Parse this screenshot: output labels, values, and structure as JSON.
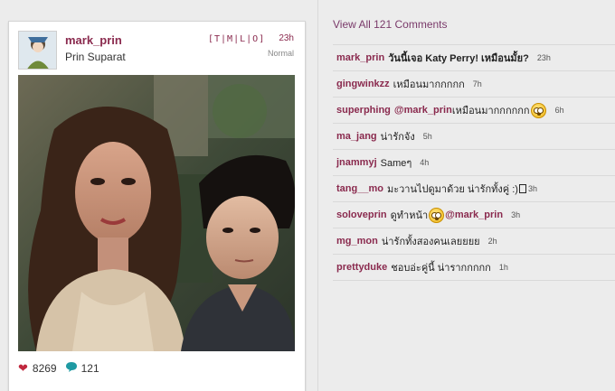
{
  "post": {
    "username": "mark_prin",
    "fullname": "Prin Suparat",
    "filters": "[T|M|L|O]",
    "time": "23h",
    "filter_name": "Normal",
    "likes": "8269",
    "comments_count": "121",
    "heart_icon": "heart-icon",
    "comment_icon": "speech-bubble-icon"
  },
  "comments_panel": {
    "view_all": "View All 121 Comments",
    "comments": [
      {
        "user": "mark_prin",
        "text": "วันนี้เจอ Katy Perry! เหมือนมั้ย?",
        "time": "23h"
      },
      {
        "user": "gingwinkzz",
        "text": "เหมือนมากกกกก",
        "time": "7h"
      },
      {
        "user": "superphing",
        "mention": "@mark_prin",
        "text": "เหมือนมากกกกกก",
        "emoji": "flushed-face-icon",
        "time": "6h"
      },
      {
        "user": "ma_jang",
        "text": "น่ารักจัง",
        "time": "5h"
      },
      {
        "user": "jnammyj",
        "text": "Sameๆ",
        "time": "4h"
      },
      {
        "user": "tang__mo",
        "text": "มะวานไปดูมาด้วย น่ารักทั้งคู่ :)",
        "time": "3h"
      },
      {
        "user": "soloveprin",
        "text": "ดูทำหน้า",
        "emoji": "flushed-face-icon",
        "mention": "@mark_prin",
        "time": "3h"
      },
      {
        "user": "mg_mon",
        "text": "น่ารักทั้งสองคนเลยยยย",
        "time": "2h"
      },
      {
        "user": "prettyduke",
        "text": "ชอบอ่ะคู่นี้ น่ารากกกกก",
        "time": "1h"
      }
    ]
  },
  "colors": {
    "username": "#8a2a4e",
    "heart": "#c0283e",
    "comment_bubble": "#1f9aa3",
    "background": "#ececec"
  }
}
